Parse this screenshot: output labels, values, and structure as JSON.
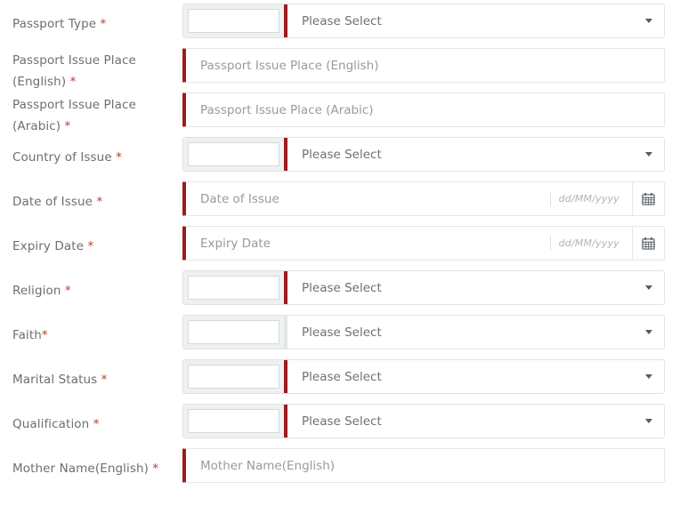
{
  "theme": {
    "accent_red": "#9c1b20",
    "required_mark_color": "#c0392b",
    "label_color": "#6e6e6e",
    "placeholder_color": "#9a9a9a",
    "muted_divider": "#e3e6e7"
  },
  "form": {
    "select_placeholder": "Please Select",
    "date_hint": "dd/MM/yyyy",
    "rows": [
      {
        "label": "Passport Type",
        "required_mark": "*",
        "label_space_before_mark": true,
        "type": "select",
        "value": "Please Select",
        "accent": "red"
      },
      {
        "label": "Passport Issue Place (English)",
        "label_line1": "Passport Issue Place",
        "label_line2": "(English)",
        "required_mark": "*",
        "label_space_before_mark": true,
        "type": "text",
        "placeholder": "Passport Issue Place (English)",
        "value": "",
        "accent": "red"
      },
      {
        "label": "Passport Issue Place (Arabic)",
        "label_line1": "Passport Issue Place",
        "label_line2": "(Arabic)",
        "required_mark": "*",
        "label_space_before_mark": true,
        "type": "text",
        "placeholder": "Passport Issue Place (Arabic)",
        "value": "",
        "accent": "red"
      },
      {
        "label": "Country of Issue",
        "required_mark": "*",
        "label_space_before_mark": true,
        "type": "select",
        "value": "Please Select",
        "accent": "red"
      },
      {
        "label": "Date of Issue",
        "required_mark": "*",
        "label_space_before_mark": true,
        "type": "date",
        "placeholder": "Date of Issue",
        "hint": "dd/MM/yyyy",
        "value": "",
        "accent": "red"
      },
      {
        "label": "Expiry Date",
        "required_mark": "*",
        "label_space_before_mark": true,
        "type": "date",
        "placeholder": "Expiry Date",
        "hint": "dd/MM/yyyy",
        "value": "",
        "accent": "red"
      },
      {
        "label": "Religion",
        "required_mark": "*",
        "label_space_before_mark": true,
        "type": "select",
        "value": "Please Select",
        "accent": "red"
      },
      {
        "label": "Faith",
        "required_mark": "*",
        "label_space_before_mark": false,
        "type": "select",
        "value": "Please Select",
        "accent": "muted"
      },
      {
        "label": "Marital Status",
        "required_mark": "*",
        "label_space_before_mark": true,
        "type": "select",
        "value": "Please Select",
        "accent": "red"
      },
      {
        "label": "Qualification",
        "required_mark": "*",
        "label_space_before_mark": true,
        "type": "select",
        "value": "Please Select",
        "accent": "red"
      },
      {
        "label": "Mother Name(English)",
        "required_mark": "*",
        "label_space_before_mark": true,
        "type": "text",
        "placeholder": "Mother Name(English)",
        "value": "",
        "accent": "red"
      }
    ]
  },
  "icons": {
    "calendar": "calendar-icon",
    "dropdown": "chevron-down-icon"
  }
}
